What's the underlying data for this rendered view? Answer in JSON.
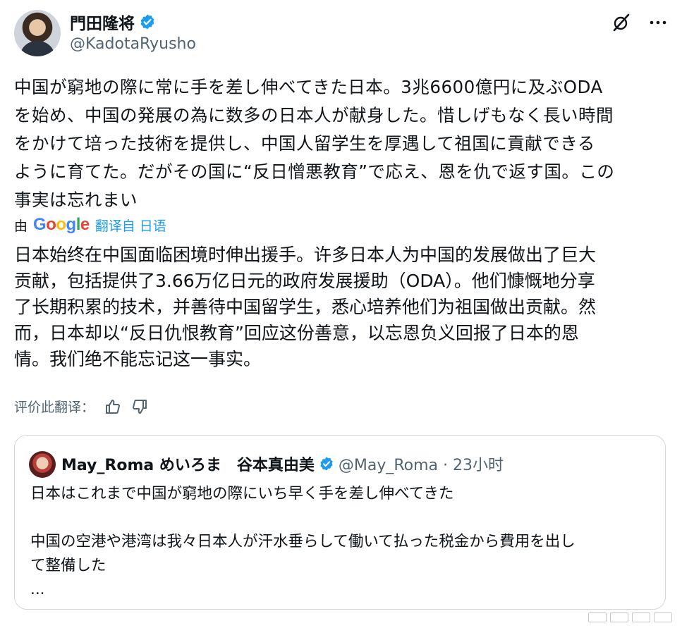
{
  "author": {
    "display_name": "門田隆将",
    "handle": "@KadotaRyusho"
  },
  "tweet": {
    "text": "中国が窮地の際に常に手を差し伸べてきた日本。3兆6600億円に及ぶODA\nを始め、中国の発展の為に数多の日本人が献身した。惜しげもなく長い時間\nをかけて培った技術を提供し、中国人留学生を厚遇して祖国に貢献できる\nように育てた。だがその国に“反日憎悪教育”で応え、恩を仇で返す国。この\n事実は忘れまい"
  },
  "translation": {
    "by_label": "由",
    "google": [
      "G",
      "o",
      "o",
      "g",
      "l",
      "e"
    ],
    "link_label": "翻译自 日语",
    "text": "日本始终在中国面临困境时伸出援手。许多日本人为中国的发展做出了巨大\n贡献，包括提供了3.66万亿日元的政府发展援助（ODA）。他们慷慨地分享\n了长期积累的技术，并善待中国留学生，悉心培养他们为祖国做出贡献。然\n而，日本却以“反日仇恨教育”回应这份善意，以忘恩负义回报了日本的恩\n情。我们绝不能忘记这一事实。",
    "rate_label": "评价此翻译："
  },
  "quote": {
    "display_name": "May_Roma めいろま　谷本真由美",
    "handle_time": "@May_Roma · 23小时",
    "text": "日本はこれまで中国が窮地の際にいち早く手を差し伸べてきた\n\n中国の空港や港湾は我々日本人が汗水垂らして働いて払った税金から費用を出し\nて整備した\n..."
  },
  "colors": {
    "accent": "#1d9bf0",
    "muted": "#536471",
    "border": "#cfd9de"
  }
}
